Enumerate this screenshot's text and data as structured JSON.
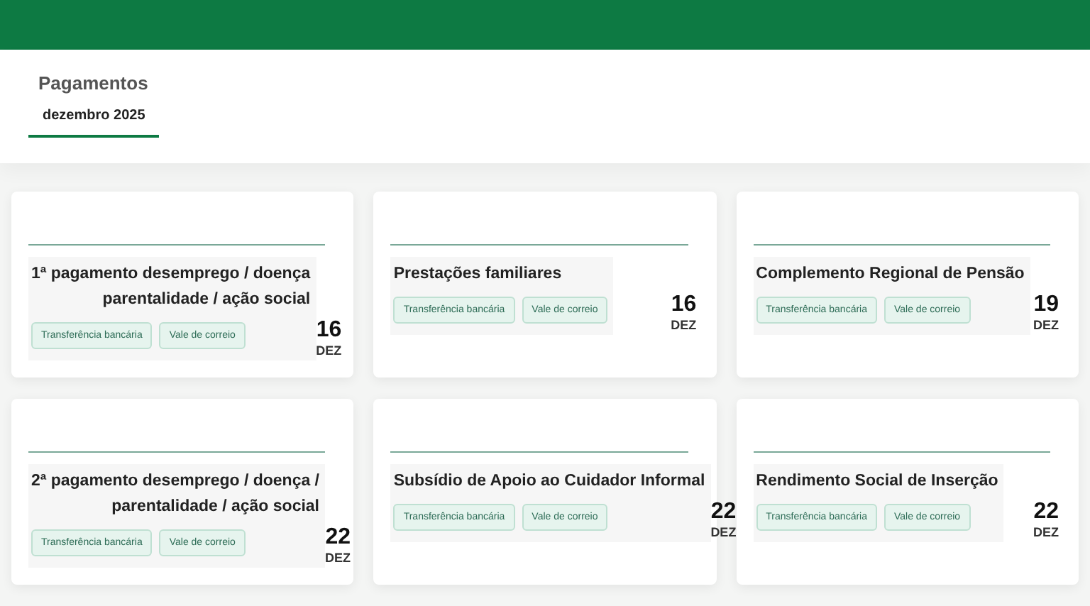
{
  "header": {
    "title": "Pagamentos",
    "tabs": [
      {
        "label": "dezembro 2025",
        "selected": true
      }
    ]
  },
  "cards": [
    {
      "title_lines": [
        "1ª pagamento desemprego / doença",
        "parentalidade / ação social"
      ],
      "tags": [
        "Transferência bancária",
        "Vale de correio"
      ],
      "day": "16",
      "month": "DEZ"
    },
    {
      "title_lines": [
        "Prestações familiares"
      ],
      "tags": [
        "Transferência bancária",
        "Vale de correio"
      ],
      "day": "16",
      "month": "DEZ"
    },
    {
      "title_lines": [
        "Complemento Regional de Pensão"
      ],
      "tags": [
        "Transferência bancária",
        "Vale de correio"
      ],
      "day": "19",
      "month": "DEZ"
    },
    {
      "title_lines": [
        "2ª pagamento desemprego / doença /",
        "parentalidade / ação social"
      ],
      "tags": [
        "Transferência bancária",
        "Vale de correio"
      ],
      "day": "22",
      "month": "DEZ"
    },
    {
      "title_lines": [
        "Subsídio de Apoio ao Cuidador Informal"
      ],
      "tags": [
        "Transferência bancária",
        "Vale de correio"
      ],
      "day": "22",
      "month": "DEZ"
    },
    {
      "title_lines": [
        "Rendimento Social de Inserção"
      ],
      "tags": [
        "Transferência bancária",
        "Vale de correio"
      ],
      "day": "22",
      "month": "DEZ"
    }
  ]
}
